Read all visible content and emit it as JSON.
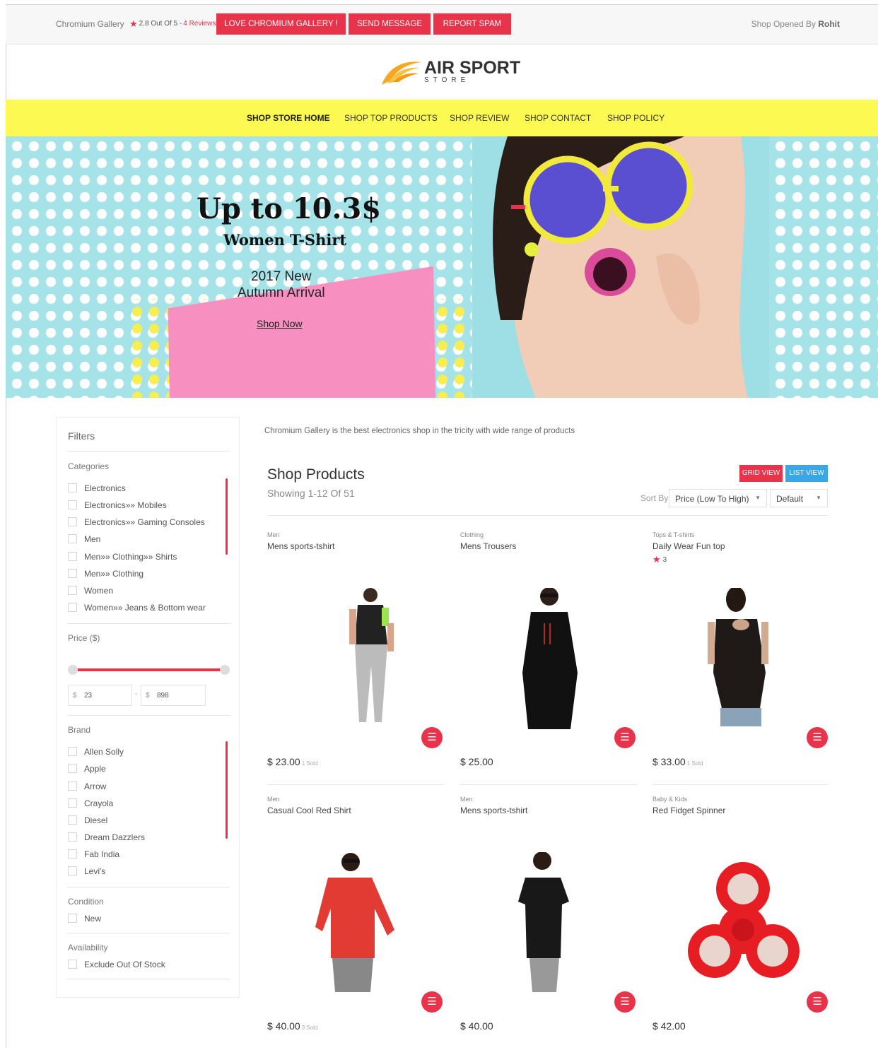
{
  "topbar": {
    "shop_name": "Chromium Gallery",
    "rating_text": "2.8 Out Of 5 -",
    "reviews": "4 Reviews",
    "buttons": [
      "LOVE CHROMIUM GALLERY !",
      "SEND MESSAGE",
      "REPORT SPAM"
    ],
    "opened_prefix": "Shop Opened By",
    "opened_by": "Rohit"
  },
  "logo": {
    "title": "AIR SPORT",
    "subtitle": "STORE"
  },
  "nav": [
    "SHOP STORE HOME",
    "SHOP TOP PRODUCTS",
    "SHOP REVIEW",
    "SHOP CONTACT",
    "SHOP POLICY"
  ],
  "hero": {
    "headline": "Up to 10.3$",
    "subheadline": "Women T-Shirt",
    "line1": "2017 New",
    "line2": "Autumn Arrival",
    "cta": "Shop Now"
  },
  "filters": {
    "title": "Filters",
    "categories_label": "Categories",
    "categories": [
      "Electronics",
      "Electronics»» Mobiles",
      "Electronics»» Gaming Consoles",
      "Men",
      "Men»» Clothing»» Shirts",
      "Men»» Clothing",
      "Women",
      "Women»» Jeans & Bottom wear"
    ],
    "price_label": "Price ($)",
    "price_currency": "$",
    "price_min": "23",
    "price_max": "898",
    "price_dash": "-",
    "brand_label": "Brand",
    "brands": [
      "Allen Solly",
      "Apple",
      "Arrow",
      "Crayola",
      "Diesel",
      "Dream Dazzlers",
      "Fab India",
      "Levi's"
    ],
    "condition_label": "Condition",
    "conditions": [
      "New"
    ],
    "availability_label": "Availability",
    "availability": [
      "Exclude Out Of Stock"
    ]
  },
  "main": {
    "description": "Chromium Gallery is the best electronics shop in the tricity with wide range of products",
    "title": "Shop Products",
    "showing": "Showing 1-12 Of 51",
    "grid_view": "GRID VIEW",
    "list_view": "LIST VIEW",
    "sort_by": "Sort By",
    "sort_value": "Price (Low To High)",
    "sort_value2": "Default"
  },
  "products": [
    {
      "category": "Men",
      "name": "Mens sports-tshirt",
      "price": "$ 23.00",
      "sold": "1 Sold",
      "rating": ""
    },
    {
      "category": "Clothing",
      "name": "Mens Trousers",
      "price": "$ 25.00",
      "sold": "",
      "rating": ""
    },
    {
      "category": "Tops & T-shirts",
      "name": "Daily Wear Fun top",
      "price": "$ 33.00",
      "sold": "1 Sold",
      "rating": "3"
    },
    {
      "category": "Men",
      "name": "Casual Cool Red Shirt",
      "price": "$ 40.00",
      "sold": "3 Sold",
      "rating": ""
    },
    {
      "category": "Men",
      "name": "Mens sports-tshirt",
      "price": "$ 40.00",
      "sold": "",
      "rating": ""
    },
    {
      "category": "Baby & Kids",
      "name": "Red Fidget Spinner",
      "price": "$ 42.00",
      "sold": "",
      "rating": ""
    }
  ],
  "colors": {
    "accent": "#e8334a",
    "nav_bg": "#fcfa52",
    "list_view": "#3aa6e8",
    "hero_bg": "#a6e3e8"
  }
}
